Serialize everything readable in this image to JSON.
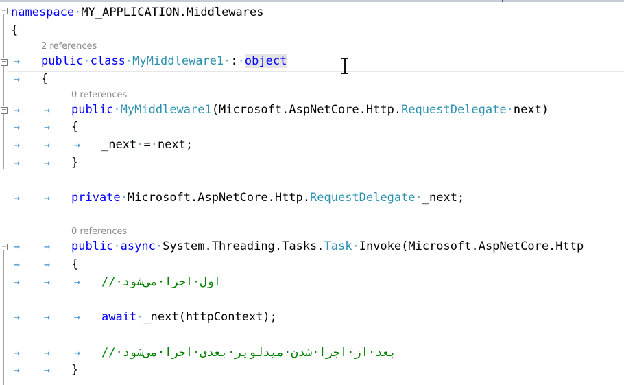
{
  "editor": {
    "code_lens": {
      "class_refs": "2 references",
      "ctor_refs": "0 references",
      "invoke_refs": "0 references"
    },
    "fold_glyph": "−",
    "tab_arrow": "→",
    "ws_dot": "·",
    "lines": {
      "l1": {
        "kw": "namespace",
        "name": "MY_APPLICATION.Middlewares"
      },
      "l2": {
        "text": "{"
      },
      "l3": {
        "kw1": "public",
        "kw2": "class",
        "type": "MyMiddleware1",
        "colon": ":",
        "base": "object"
      },
      "l4": {
        "text": "{"
      },
      "l5": {
        "kw": "public",
        "name": "MyMiddleware1",
        "rest1": "(Microsoft.AspNetCore.Http.",
        "type": "RequestDelegate",
        "rest2": "next)"
      },
      "l6": {
        "text": "{"
      },
      "l7": {
        "field": "_next",
        "op": "=",
        "val": "next;"
      },
      "l8": {
        "text": "}"
      },
      "l9": {
        "kw": "private",
        "ns": "Microsoft.AspNetCore.Http.",
        "type": "RequestDelegate",
        "field": "_next;"
      },
      "l10": {
        "kw1": "public",
        "kw2": "async",
        "ns": "System.Threading.Tasks.",
        "type": "Task",
        "rest": "Invoke(Microsoft.AspNetCore.Http"
      },
      "l11": {
        "text": "{"
      },
      "l12": {
        "comment": "//·اول·اجرا·می‌شود"
      },
      "l13": {
        "kw": "await",
        "rest": "_next(httpContext);"
      },
      "l14": {
        "comment": "//·بعد·از·اجرا·شدن·میدلویر·بعدی·اجرا·می‌شود"
      },
      "l15": {
        "text": "}"
      }
    }
  }
}
